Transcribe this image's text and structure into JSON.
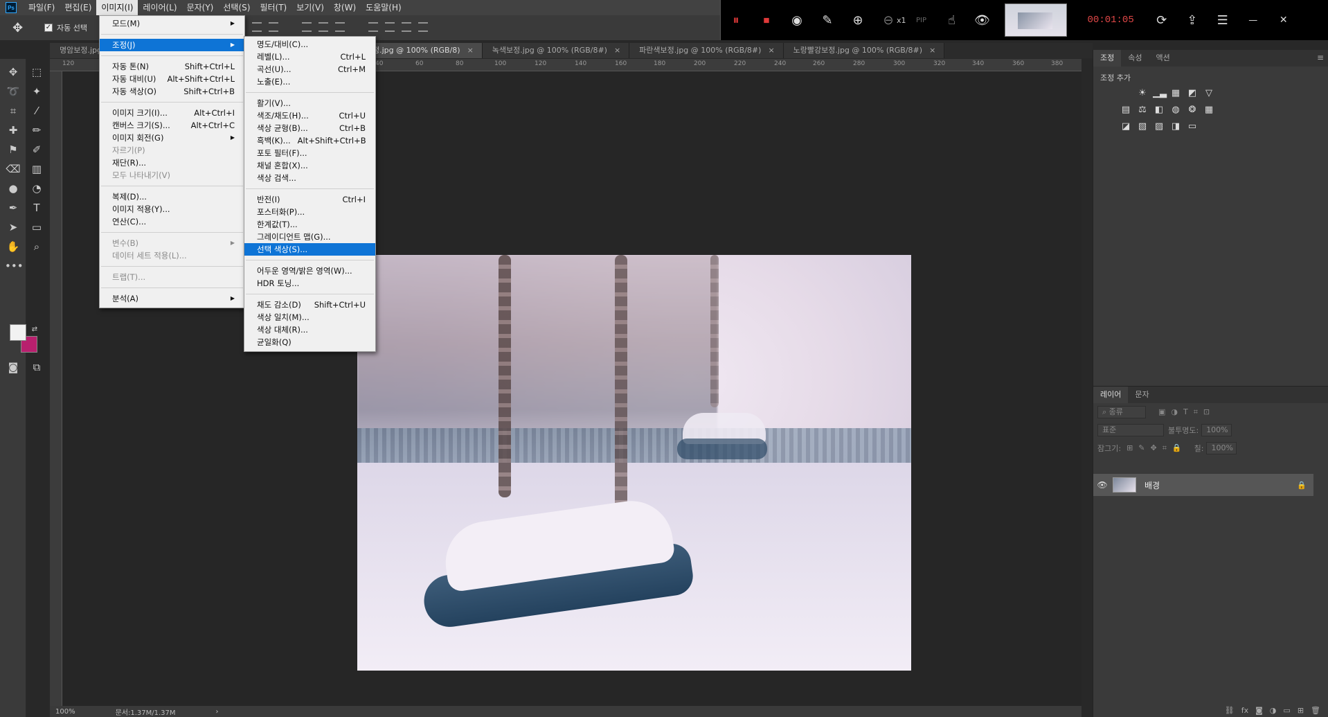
{
  "menubar": {
    "logo": "Ps",
    "items": [
      "파일(F)",
      "편집(E)",
      "이미지(I)",
      "레이어(L)",
      "문자(Y)",
      "선택(S)",
      "필터(T)",
      "보기(V)",
      "창(W)",
      "도움말(H)"
    ],
    "active_index": 2,
    "window_controls": [
      "—",
      "✕"
    ]
  },
  "recorder": {
    "time": "00:01:05",
    "zoom": "x1",
    "icons": [
      "pause-icon",
      "stop-icon",
      "screenshot-icon",
      "pen-icon",
      "zoom-in-icon",
      "zoom-out-icon",
      "pip-icon",
      "mouse-icon",
      "eye-icon"
    ]
  },
  "options": {
    "auto_select_label": "자동 선택"
  },
  "tabs": [
    {
      "label": "명암보정.jpg"
    },
    {
      "label": "정.jpg @ 100% (RGB/8)",
      "active": true
    },
    {
      "label": "녹색보정.jpg @ 100% (RGB/8#)"
    },
    {
      "label": "파란색보정.jpg @ 100% (RGB/8#)"
    },
    {
      "label": "노랑빨강보정.jpg @ 100% (RGB/8#)"
    }
  ],
  "ruler_ticks": [
    "120",
    "40",
    "60",
    "80",
    "100",
    "120",
    "140",
    "160",
    "180",
    "200",
    "220",
    "240",
    "260",
    "280",
    "300",
    "320",
    "340",
    "360",
    "380"
  ],
  "statusbar": {
    "zoom": "100%",
    "doc": "문서:1.37M/1.37M"
  },
  "image_menu": [
    {
      "label": "모드(M)",
      "submenu": true
    },
    {
      "sep": true
    },
    {
      "label": "조정(J)",
      "submenu": true,
      "highlight": true
    },
    {
      "sep": true
    },
    {
      "label": "자동 톤(N)",
      "shortcut": "Shift+Ctrl+L"
    },
    {
      "label": "자동 대비(U)",
      "shortcut": "Alt+Shift+Ctrl+L"
    },
    {
      "label": "자동 색상(O)",
      "shortcut": "Shift+Ctrl+B"
    },
    {
      "sep": true
    },
    {
      "label": "이미지 크기(I)...",
      "shortcut": "Alt+Ctrl+I"
    },
    {
      "label": "캔버스 크기(S)...",
      "shortcut": "Alt+Ctrl+C"
    },
    {
      "label": "이미지 회전(G)",
      "submenu": true
    },
    {
      "label": "자르기(P)",
      "disabled": true
    },
    {
      "label": "재단(R)..."
    },
    {
      "label": "모두 나타내기(V)",
      "disabled": true
    },
    {
      "sep": true
    },
    {
      "label": "복제(D)..."
    },
    {
      "label": "이미지 적용(Y)..."
    },
    {
      "label": "연산(C)..."
    },
    {
      "sep": true
    },
    {
      "label": "변수(B)",
      "submenu": true,
      "disabled": true
    },
    {
      "label": "데이터 세트 적용(L)...",
      "disabled": true
    },
    {
      "sep": true
    },
    {
      "label": "트랩(T)...",
      "disabled": true
    },
    {
      "sep": true
    },
    {
      "label": "분석(A)",
      "submenu": true
    }
  ],
  "adjust_menu": [
    {
      "label": "명도/대비(C)..."
    },
    {
      "label": "레벨(L)...",
      "shortcut": "Ctrl+L"
    },
    {
      "label": "곡선(U)...",
      "shortcut": "Ctrl+M"
    },
    {
      "label": "노출(E)..."
    },
    {
      "sep": true
    },
    {
      "label": "활기(V)..."
    },
    {
      "label": "색조/채도(H)...",
      "shortcut": "Ctrl+U"
    },
    {
      "label": "색상 균형(B)...",
      "shortcut": "Ctrl+B"
    },
    {
      "label": "흑백(K)...",
      "shortcut": "Alt+Shift+Ctrl+B"
    },
    {
      "label": "포토 필터(F)..."
    },
    {
      "label": "채널 혼합(X)..."
    },
    {
      "label": "색상 검색..."
    },
    {
      "sep": true
    },
    {
      "label": "반전(I)",
      "shortcut": "Ctrl+I"
    },
    {
      "label": "포스터화(P)..."
    },
    {
      "label": "한계값(T)..."
    },
    {
      "label": "그레이디언트 맵(G)..."
    },
    {
      "label": "선택 색상(S)...",
      "highlight": true
    },
    {
      "sep": true
    },
    {
      "label": "어두운 영역/밝은 영역(W)..."
    },
    {
      "label": "HDR 토닝..."
    },
    {
      "sep": true
    },
    {
      "label": "채도 감소(D)",
      "shortcut": "Shift+Ctrl+U"
    },
    {
      "label": "색상 일치(M)..."
    },
    {
      "label": "색상 대체(R)..."
    },
    {
      "label": "균일화(Q)"
    }
  ],
  "right_panel": {
    "top_tabs": [
      "조정",
      "속성",
      "액션"
    ],
    "adjust_title": "조정 추가",
    "layer_tabs": [
      "레이어",
      "문자"
    ],
    "filter_label": "종류",
    "blend_mode": "표준",
    "opacity_label": "불투명도:",
    "opacity_value": "100%",
    "lock_label": "잠그기:",
    "fill_label": "칠:",
    "fill_value": "100%",
    "layer_name": "배경"
  }
}
